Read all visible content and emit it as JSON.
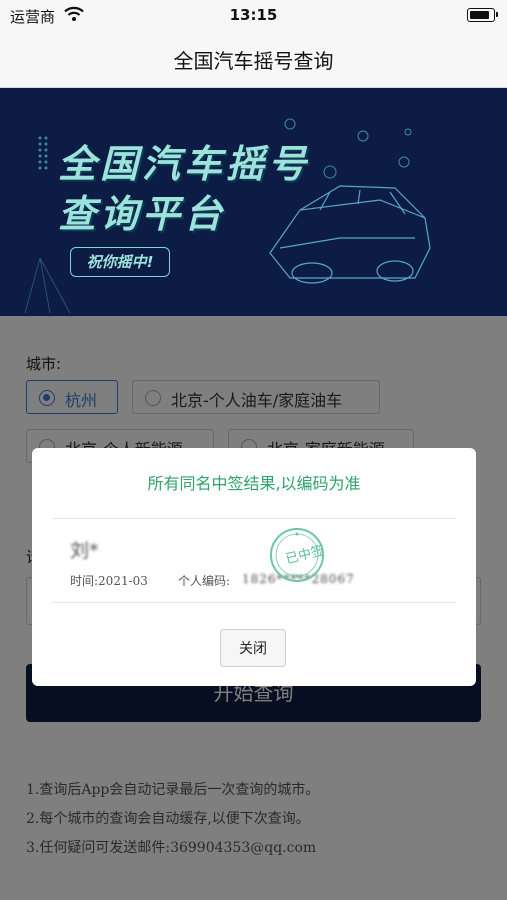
{
  "status_bar": {
    "carrier": "运营商",
    "time": "13:15"
  },
  "nav": {
    "title": "全国汽车摇号查询"
  },
  "banner": {
    "title_line1": "全国汽车摇号",
    "title_line2": "查询平台",
    "badge": "祝你摇中!"
  },
  "form": {
    "city_label": "城市:",
    "cities": [
      {
        "label": "杭州",
        "selected": true
      },
      {
        "label": "北京-个人油车/家庭油车",
        "selected": false
      },
      {
        "label": "北京-个人新能源",
        "selected": false
      },
      {
        "label": "北京-家庭新能源",
        "selected": false
      }
    ],
    "input_label": "请",
    "query_button": "开始查询"
  },
  "tips": [
    "1.查询后App会自动记录最后一次查询的城市。",
    "2.每个城市的查询会自动缓存,以便下次查询。",
    "3.任何疑问可发送邮件:369904353@qq.com"
  ],
  "dialog": {
    "title": "所有同名中签结果,以编码为准",
    "record": {
      "name": "刘*",
      "time_label": "时间:2021-03",
      "code_label": "个人编码:",
      "code": "1826*****28067"
    },
    "stamp": "已中签",
    "close_button": "关闭"
  },
  "colors": {
    "navy": "#0c1c45",
    "accent_blue": "#3a7bd5",
    "success_green": "#2ea36a"
  }
}
